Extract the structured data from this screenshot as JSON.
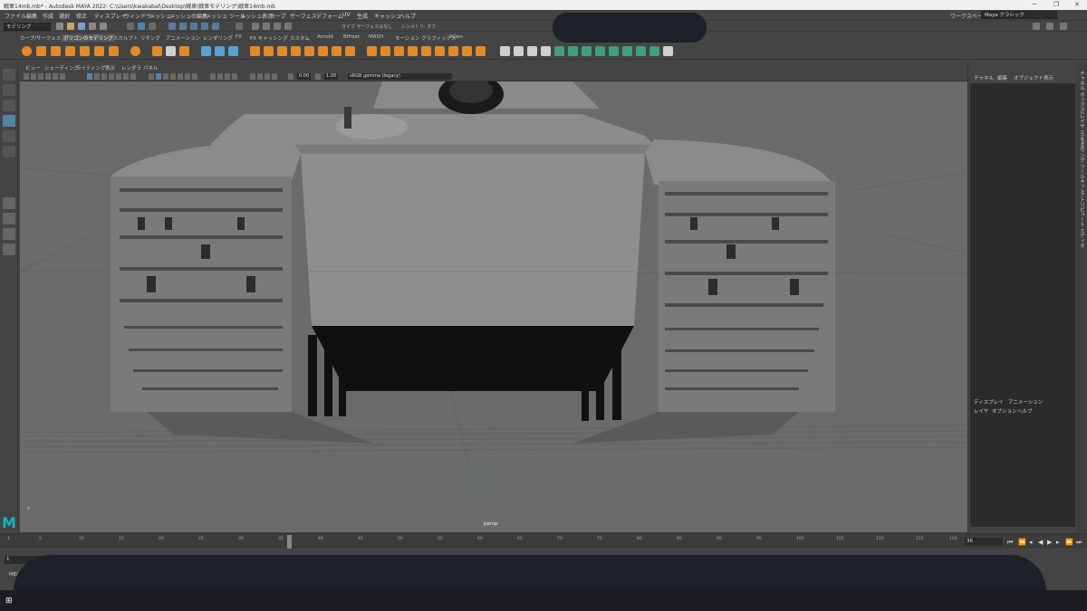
{
  "window": {
    "title": "戦車14mb.mb* - Autodesk MAYA 2022: C:\\Users\\kwakabal\\Desktop\\戦車\\戦車モデリング\\戦車14mb.mb"
  },
  "menubar": {
    "items": [
      "ファイル",
      "編集",
      "作成",
      "選択",
      "修正",
      "ディスプレイ",
      "ウィンドウ",
      "メッシュ",
      "メッシュの編集",
      "メッシュ ツール",
      "メッシュ表示",
      "カーブ",
      "サーフェス",
      "デフォーム",
      "UV",
      "生成",
      "キャッシュ",
      "ヘルプ"
    ],
    "workspace_label": "ワークスペース",
    "workspace_value": "Maya クラシック"
  },
  "statusline": {
    "mode": "モデリング",
    "symmetry_label": "シンメトリ: オフ",
    "live_label": "ライブ サーフェスはなし"
  },
  "shelf": {
    "tabs": [
      "カーブ/サーフェス",
      "ポリゴンのモデリング",
      "スカルプト",
      "リギング",
      "アニメーション",
      "レンダリング",
      "FX",
      "FX キャッシング",
      "カスタム",
      "Arnold",
      "Bifrost",
      "MASH",
      "モーション グラフィックス",
      "XGen"
    ],
    "active_tab": "ポリゴンのモデリング"
  },
  "viewport": {
    "menu": [
      "ビュー",
      "シェーディング",
      "ライティング",
      "表示",
      "レンダラ",
      "パネル"
    ],
    "exposure": "0.00",
    "gamma": "1.00",
    "colorspace": "sRGB gamma (legacy)",
    "camera": "persp",
    "axis_label": "Y"
  },
  "channelbox": {
    "menu": [
      "チャネル",
      "編集",
      "オブジェクト",
      "表示"
    ],
    "layer_tabs": [
      "ディスプレイ",
      "アニメーション"
    ],
    "layer_menu": [
      "レイヤ",
      "オプション",
      "ヘルプ"
    ]
  },
  "sidetabs": [
    "チャネル ボックス/レイヤ エディタ",
    "モデリング ツールキット",
    "アトリビュート エディタ"
  ],
  "timeline": {
    "ticks": [
      1,
      5,
      10,
      15,
      20,
      25,
      30,
      35,
      40,
      45,
      50,
      55,
      60,
      65,
      70,
      75,
      80,
      85,
      90,
      95,
      100,
      105,
      110,
      115,
      120
    ],
    "current_frame": "36",
    "range_start": "1"
  },
  "commandline": {
    "language": "MEL"
  },
  "colors": {
    "ui_bg": "#444444",
    "viewport_bg": "#6b6b6b",
    "accent": "#17b3c4",
    "selected": "#5285a6",
    "shelf_orange": "#e08a2c"
  }
}
